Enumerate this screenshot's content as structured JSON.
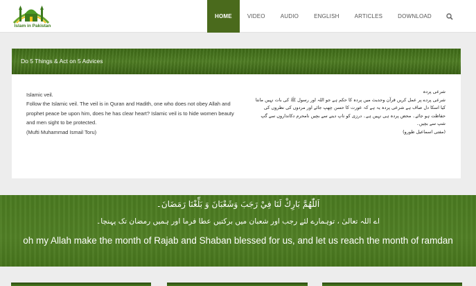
{
  "header": {
    "logo_text": "Islam in Pakistan",
    "nav": [
      {
        "label": "HOME",
        "active": true
      },
      {
        "label": "VIDEO",
        "active": false
      },
      {
        "label": "AUDIO",
        "active": false
      },
      {
        "label": "ENGLISH",
        "active": false
      },
      {
        "label": "ARTICLES",
        "active": false
      },
      {
        "label": "DOWNLOAD",
        "active": false
      }
    ],
    "search_icon": "search-icon"
  },
  "article": {
    "title": "Do 5 Things & Act on 5 Advices",
    "english": {
      "heading": "Islamic veil.",
      "body": "Follow the Islamic veil. The veil is in Quran and Hadith, one who does not obey Allah and prophet peace be upon him, does he has clear heart? Islamic veil is to hide women beauty and men sight to be protected.",
      "author": "(Mufti Muhammad Ismail Toru)"
    },
    "urdu": {
      "heading": "شرعی پردہ",
      "body": "شرعی پردے پر عمل کریں قرآن وحدیث میں پردہ کا حکم ہے جو اللہ اور رسول ﷺ کی بات نہیں مانتا کیا اسکا دل صاف ہے شرعی پردہ یہ ہے کہ عورت کا حسن چھپ جائے اور مردوں کی نظروں کی حفاظت ہو جائے۔ محض پردہ ہی نہیں ہے۔ درزی کو ناپ دینے سے بچیں نامحرم دکانداروں سے گپ شپ سے بچیں۔",
      "author": "(مفتی اسماعیل طورو)"
    }
  },
  "banner": {
    "arabic": "اَللّٰهُمَّ بَارِكْ لَنَا فِيْ رَجَبَ وَشَعْبَانَ وَ بَلِّغْنَا رَمَضَانَ۔",
    "urdu": "اے اللہ تعالیٰ ، توہمارے لئے رجب اور شعبان میں برکتیں عطا فرما اور ہمیں رمضان تک پہنچا۔",
    "english": "oh my Allah make the month of Rajab and Shaban blessed for us, and let us reach the month of ramdan"
  },
  "colors": {
    "brand_green": "#4a6a1c",
    "banner_green": "#4f7d24"
  }
}
